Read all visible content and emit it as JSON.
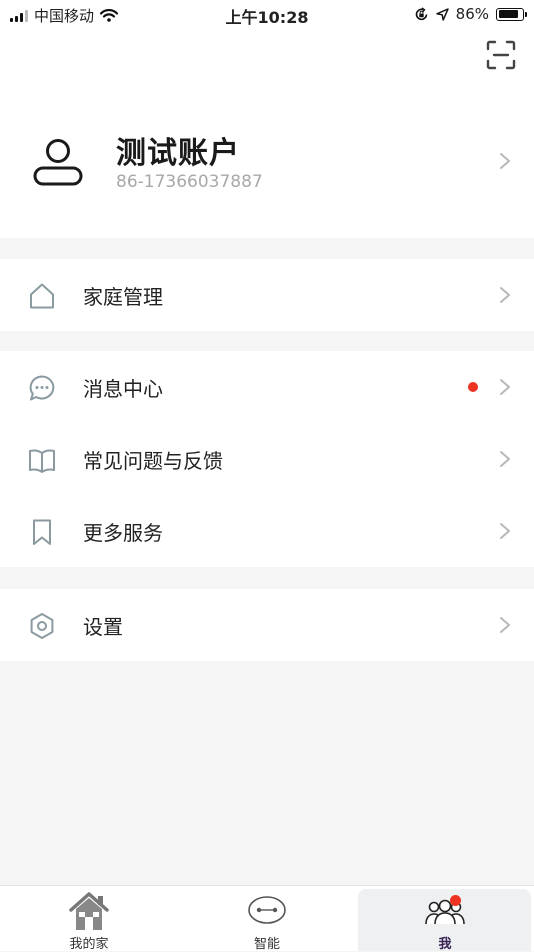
{
  "status_bar": {
    "carrier": "中国移动",
    "time": "上午10:28",
    "battery_text": "86%",
    "battery_level": 0.86,
    "icons": [
      "signal-icon",
      "wifi-icon",
      "orientation-lock-icon",
      "location-icon",
      "battery-icon"
    ]
  },
  "header": {
    "scan_icon": "scan-icon",
    "account_name": "测试账户",
    "account_phone": "86-17366037887",
    "avatar_icon": "user-icon"
  },
  "menu": {
    "family": {
      "label": "家庭管理",
      "icon": "home-outline-icon"
    },
    "messages": {
      "label": "消息中心",
      "icon": "chat-bubble-icon",
      "has_badge": true
    },
    "faq": {
      "label": "常见问题与反馈",
      "icon": "book-icon"
    },
    "services": {
      "label": "更多服务",
      "icon": "bookmark-icon"
    },
    "settings": {
      "label": "设置",
      "icon": "hexagon-settings-icon"
    }
  },
  "tabbar": {
    "tabs": [
      {
        "label": "我的家",
        "icon": "house-icon",
        "active": false
      },
      {
        "label": "智能",
        "icon": "robot-face-icon",
        "active": false
      },
      {
        "label": "我",
        "icon": "people-icon",
        "active": true,
        "badge": true
      }
    ]
  },
  "colors": {
    "badge_red": "#ee3322",
    "icon_gray": "#8a9aa0",
    "chevron_gray": "#b8b8b8",
    "active_tab_text": "#3b2456",
    "background": "#f5f5f5"
  }
}
